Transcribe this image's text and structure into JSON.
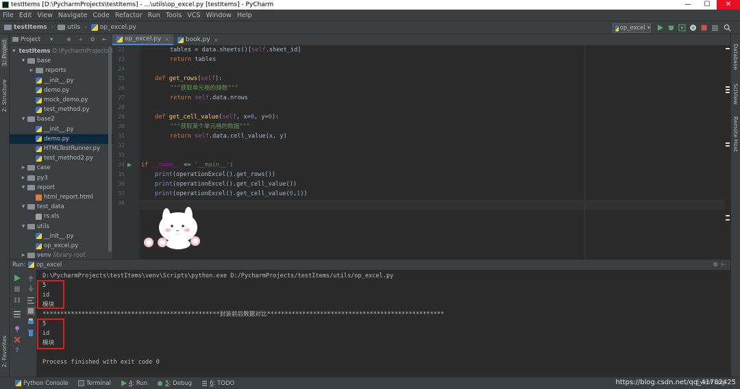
{
  "window": {
    "title": "testItems [D:\\PycharmProjects\\testItems] - ...\\utils\\op_excel.py [testItems] - PyCharm",
    "minimize": "—",
    "maximize": "☐",
    "close": "✕"
  },
  "menu": [
    "File",
    "Edit",
    "View",
    "Navigate",
    "Code",
    "Refactor",
    "Run",
    "Tools",
    "VCS",
    "Window",
    "Help"
  ],
  "breadcrumb": [
    "testItems",
    "utils",
    "op_excel.py"
  ],
  "run_config": {
    "label": "op_excel",
    "arrow": "▾"
  },
  "left_stripe": {
    "project": "1: Project",
    "structure": "2: Structure",
    "favorites": "2: Favorites"
  },
  "right_stripe": {
    "database": "Database",
    "sciview": "SciView",
    "remote_host": "Remote Host"
  },
  "project": {
    "header": "Project",
    "header_arrow": "▾",
    "header_icons": "⊕ ÷ ⚙ ⇤",
    "tree": [
      {
        "label": "testItems",
        "note": "D:\\PycharmProjects\\testItems",
        "type": "folder",
        "arrow": "▼"
      },
      {
        "label": "base",
        "type": "folder",
        "arrow": "▼"
      },
      {
        "label": "reports",
        "type": "folder",
        "arrow": "▶"
      },
      {
        "label": "__init__.py",
        "type": "py"
      },
      {
        "label": "demo.py",
        "type": "py"
      },
      {
        "label": "mock_demo.py",
        "type": "py"
      },
      {
        "label": "test_method.py",
        "type": "py"
      },
      {
        "label": "base2",
        "type": "folder",
        "arrow": "▼"
      },
      {
        "label": "__init__.py",
        "type": "py"
      },
      {
        "label": "demo.py",
        "type": "py",
        "selected": true
      },
      {
        "label": "HTMLTestRunner.py",
        "type": "py"
      },
      {
        "label": "test_method2.py",
        "type": "py"
      },
      {
        "label": "case",
        "type": "folder",
        "arrow": "▶"
      },
      {
        "label": "py3",
        "type": "folder",
        "arrow": "▶"
      },
      {
        "label": "report",
        "type": "folder",
        "arrow": "▼"
      },
      {
        "label": "html_report.html",
        "type": "html"
      },
      {
        "label": "test_data",
        "type": "folder",
        "arrow": "▼"
      },
      {
        "label": "rs.xls",
        "type": "xls"
      },
      {
        "label": "utils",
        "type": "folder",
        "arrow": "▼"
      },
      {
        "label": "__init__.py",
        "type": "py"
      },
      {
        "label": "op_excel.py",
        "type": "py"
      },
      {
        "label": "venv",
        "note": "library root",
        "type": "folder",
        "arrow": "▶"
      }
    ]
  },
  "editor": {
    "tabs": [
      {
        "label": "op_excel.py",
        "active": true,
        "close": "×"
      },
      {
        "label": "book.py",
        "active": false,
        "close": "×"
      }
    ],
    "line_numbers": [
      "22",
      "23",
      "24",
      "25",
      "26",
      "27",
      "28",
      "29",
      "30",
      "31",
      "32",
      "33",
      "34",
      "35",
      "36",
      "37",
      "38"
    ],
    "run_marker": "▶",
    "code": {
      "l22_a": "tables = data.sheets()[",
      "l22_self": "self",
      "l22_b": ".sheet_id]",
      "l23_kw": "return",
      "l23_b": " tables",
      "l25_kw": "def ",
      "l25_fn": "get_rows",
      "l25_a": "(",
      "l25_self": "self",
      "l25_b": "):",
      "l26_doc": "\"\"\"获取单元格的排数\"\"\"",
      "l27_kw": "return ",
      "l27_self": "self",
      "l27_b": ".data.nrows",
      "l29_kw": "def ",
      "l29_fn": "get_cell_value",
      "l29_a": "(",
      "l29_self": "self",
      "l29_b": ", x=",
      "l29_n0": "0",
      "l29_c": ", y=",
      "l29_n1": "0",
      "l29_d": "):",
      "l30_doc": "\"\"\"获取某个单元格的数据\"\"\"",
      "l31_kw": "return ",
      "l31_self": "self",
      "l31_b": ".data.cell_value(x, y)",
      "l34_kw": "if ",
      "l34_mg": "__name__",
      "l34_a": " == ",
      "l34_str": "'__main__'",
      "l34_b": ":",
      "l35_bi": "print",
      "l35_b": "(operationExcel().get_rows())",
      "l36_bi": "print",
      "l36_b": "(operationExcel().get_cell_value())",
      "l37_bi": "print",
      "l37_b": "(operationExcel().get_cell_value(",
      "l37_n0": "0",
      "l37_c": ",",
      "l37_n1": "1",
      "l37_d": "))"
    }
  },
  "run_panel": {
    "header_label": "Run:",
    "config": "op_excel",
    "gear": "⚙",
    "minus": "⊢",
    "output": [
      "D:\\PycharmProjects\\testItems\\venv\\Scripts\\python.exe D:/PycharmProjects/testItems/utils/op_excel.py",
      "5",
      "id",
      "模块",
      "",
      "**************************************************封装前后数据对比**************************************************",
      "5",
      "id",
      "模块",
      "",
      "Process finished with exit code 0"
    ]
  },
  "statusbar": {
    "items": [
      {
        "label": "Python Console"
      },
      {
        "label": "Terminal"
      },
      {
        "key": "4",
        "label": ": Run"
      },
      {
        "key": "5",
        "label": ": Debug"
      },
      {
        "key": "6",
        "label": ": TODO"
      }
    ],
    "watermark": "https://blog.csdn.net/qq_41782425",
    "event_log": "Event Log"
  },
  "colors": {
    "accent": "#4a88c7",
    "run_green": "#59a869",
    "stop_red": "#c75450",
    "highlight_box": "#e02020"
  }
}
